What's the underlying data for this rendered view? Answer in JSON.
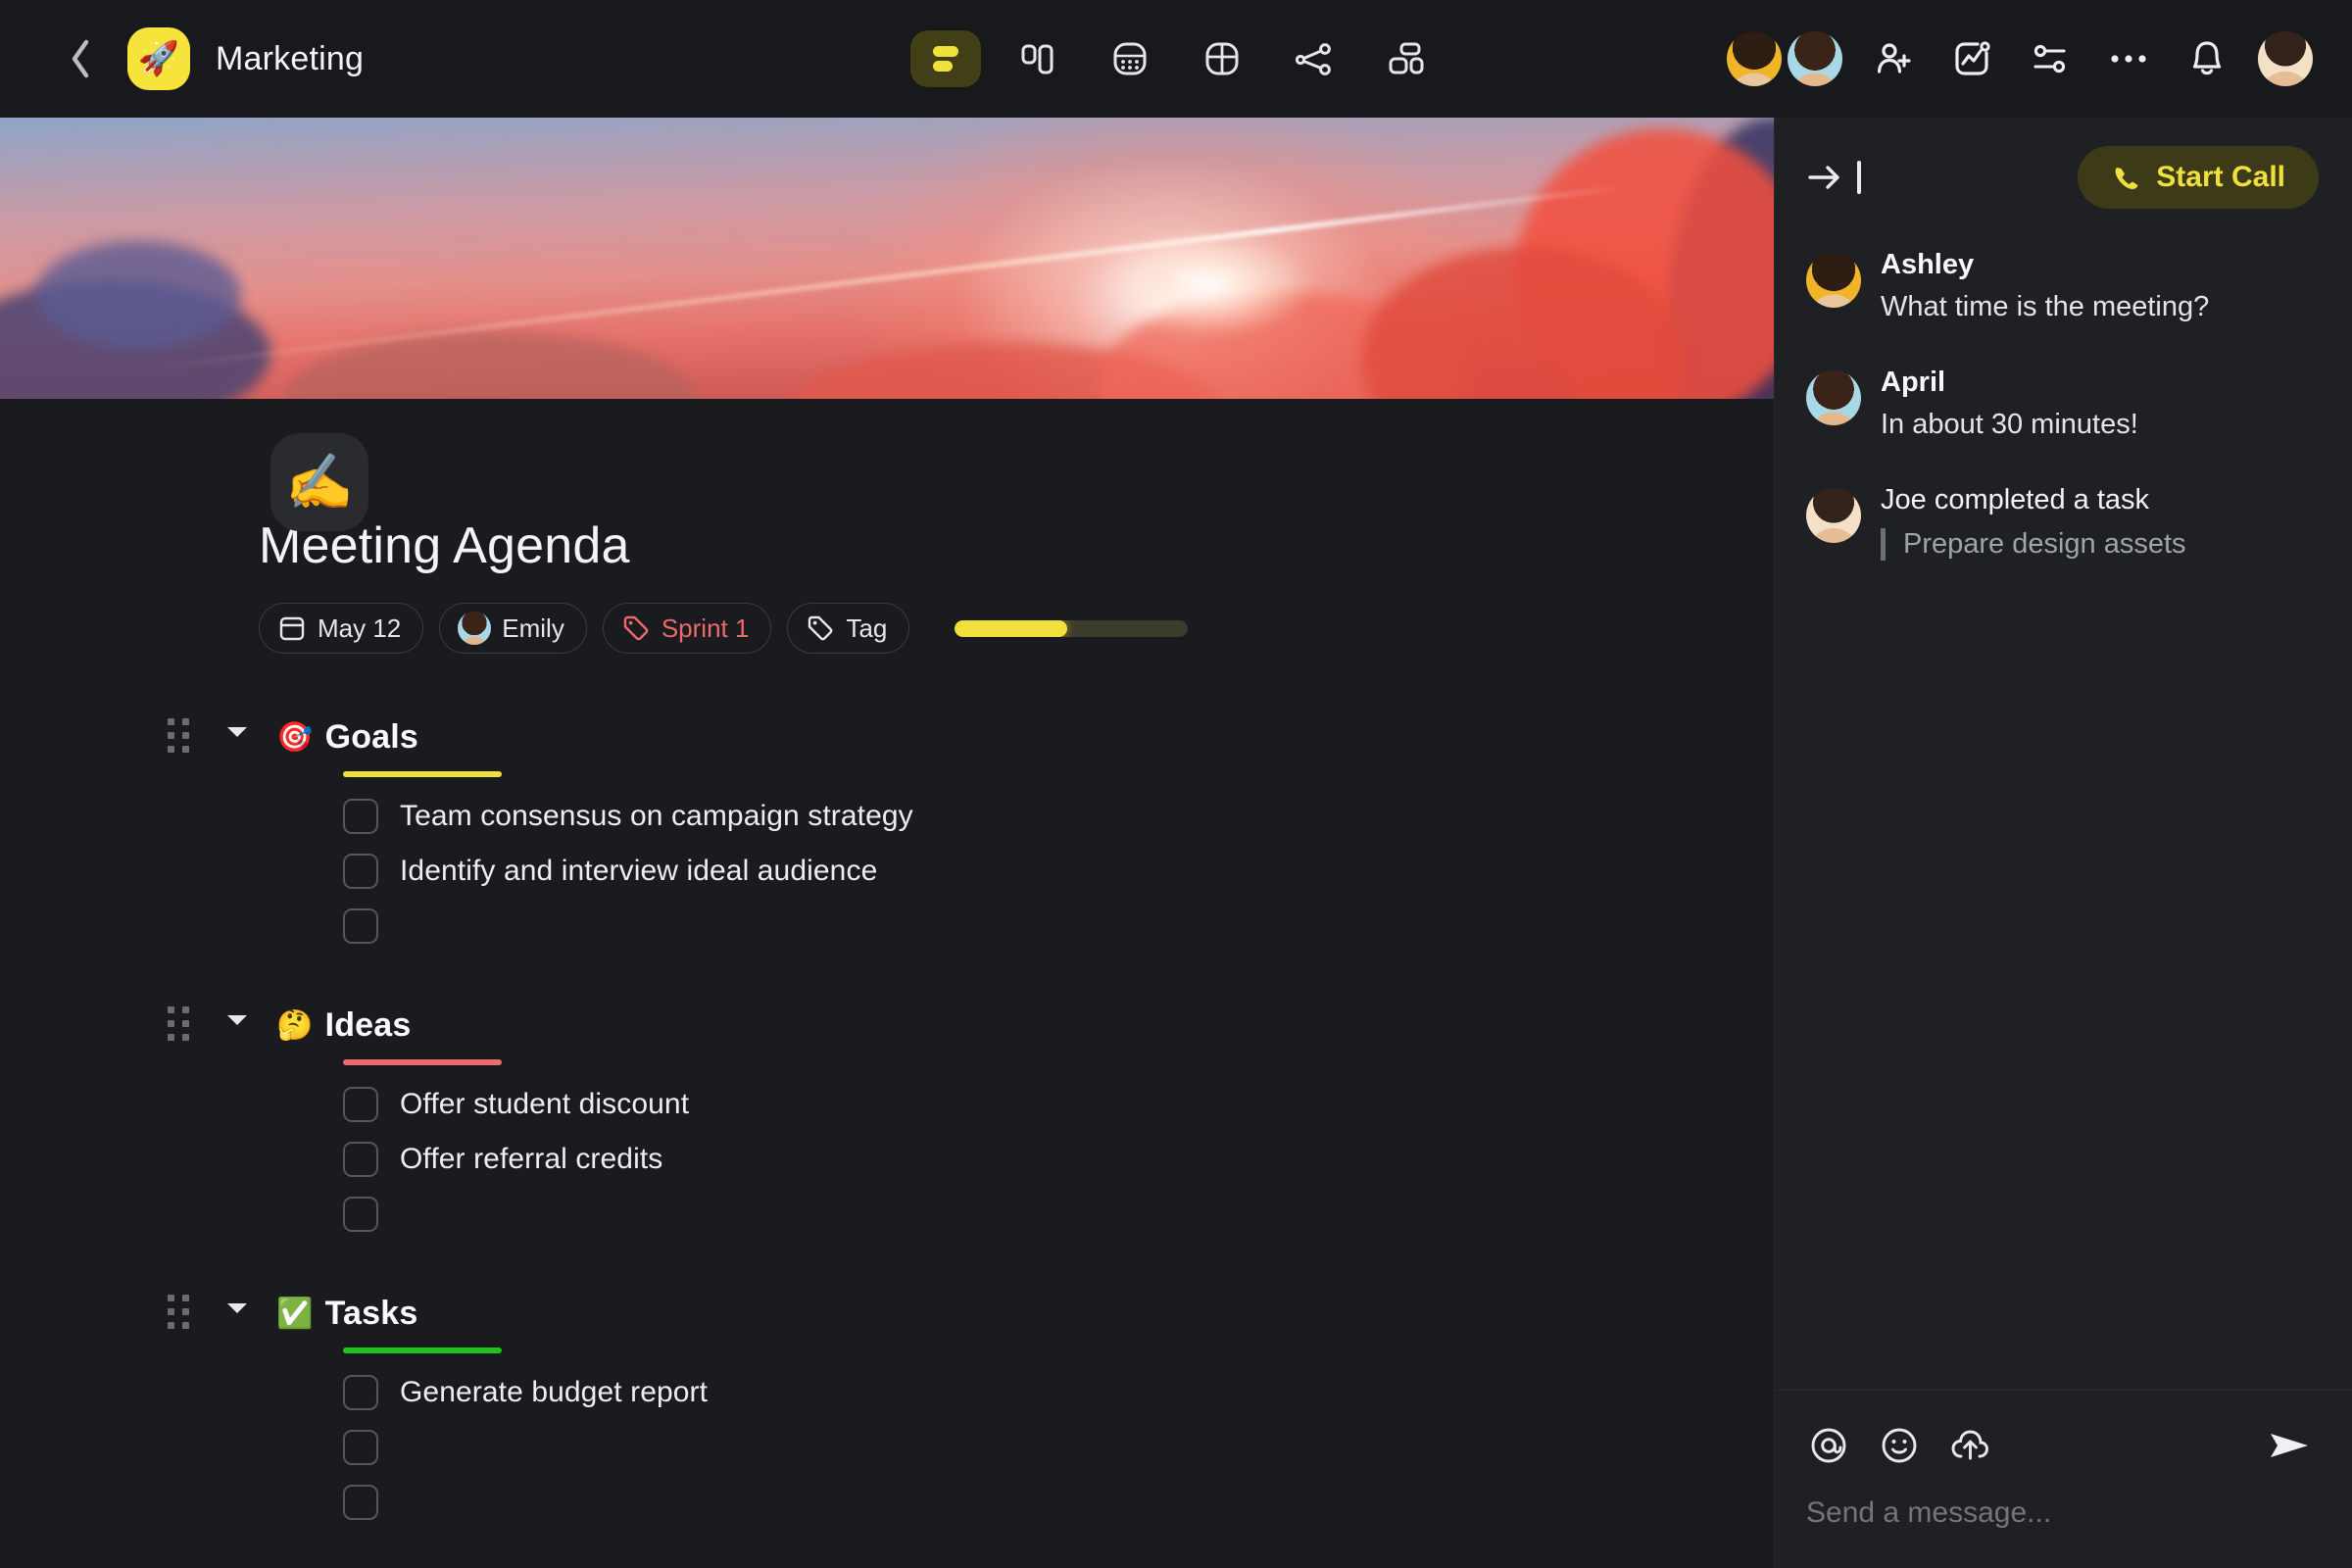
{
  "topbar": {
    "back_icon": "chevron-left-icon",
    "space_emoji": "🚀",
    "space_title": "Marketing",
    "views": [
      {
        "name": "list-view",
        "icon": "list-rows-icon",
        "active": true
      },
      {
        "name": "board-view",
        "icon": "columns-icon",
        "active": false
      },
      {
        "name": "calendar-view",
        "icon": "calendar-dots-icon",
        "active": false
      },
      {
        "name": "table-view",
        "icon": "table-grid-icon",
        "active": false
      },
      {
        "name": "graph-view",
        "icon": "share-nodes-icon",
        "active": false
      },
      {
        "name": "dashboard-view",
        "icon": "blocks-icon",
        "active": false
      }
    ],
    "members": [
      "Ashley",
      "April"
    ],
    "actions": [
      {
        "name": "invite-member",
        "icon": "user-plus-icon"
      },
      {
        "name": "activity",
        "icon": "activity-chart-icon"
      },
      {
        "name": "filters",
        "icon": "sliders-icon"
      },
      {
        "name": "more-options",
        "icon": "ellipsis-icon"
      },
      {
        "name": "notifications",
        "icon": "bell-icon"
      }
    ],
    "account": "Joe"
  },
  "document": {
    "cover_alt": "sunset-clouds-cover",
    "emoji": "✍️",
    "title": "Meeting Agenda",
    "pills": [
      {
        "name": "date-pill",
        "icon": "calendar-icon",
        "label": "May 12"
      },
      {
        "name": "assignee-pill",
        "icon": "avatar",
        "label": "Emily"
      },
      {
        "name": "sprint-tag-pill",
        "icon": "tag-icon",
        "label": "Sprint 1",
        "color": "#ed6a6a"
      },
      {
        "name": "add-tag-pill",
        "icon": "tag-icon",
        "label": "Tag"
      }
    ],
    "progress": {
      "percent": 48,
      "fill_color": "#f1e03c",
      "track_color": "#3c3c2c"
    }
  },
  "sections": [
    {
      "emoji": "🎯",
      "label": "Goals",
      "underline_color": "#f1e03c",
      "collapsed": false,
      "items": [
        {
          "text": "Team consensus on campaign strategy",
          "checked": false
        },
        {
          "text": "Identify and interview ideal audience",
          "checked": false
        },
        {
          "text": "",
          "checked": false
        }
      ]
    },
    {
      "emoji": "🤔",
      "label": "Ideas",
      "underline_color": "#ef6a6a",
      "collapsed": false,
      "items": [
        {
          "text": "Offer student discount",
          "checked": false
        },
        {
          "text": "Offer referral credits",
          "checked": false
        },
        {
          "text": "",
          "checked": false
        }
      ]
    },
    {
      "emoji": "✅",
      "label": "Tasks",
      "underline_color": "#1fc41f",
      "collapsed": false,
      "items": [
        {
          "text": "Generate budget report",
          "checked": false
        },
        {
          "text": "",
          "checked": false
        },
        {
          "text": "",
          "checked": false
        }
      ]
    }
  ],
  "panel": {
    "collapse_icon": "arrow-right-to-line-icon",
    "start_call": {
      "label": "Start Call",
      "icon": "phone-icon",
      "color": "#f0e03e"
    },
    "messages": [
      {
        "type": "message",
        "author": "Ashley",
        "text": "What time is the meeting?",
        "avatar": "av-ashley"
      },
      {
        "type": "message",
        "author": "April",
        "text": "In about 30 minutes!",
        "avatar": "av-april"
      },
      {
        "type": "event",
        "title": "Joe completed a task",
        "quote": "Prepare design assets",
        "avatar": "av-joe"
      }
    ],
    "composer": {
      "placeholder": "Send a message...",
      "tools": [
        {
          "name": "mention-icon",
          "glyph": "@"
        },
        {
          "name": "emoji-icon",
          "glyph": "smiley"
        },
        {
          "name": "upload-icon",
          "glyph": "cloud-upload"
        }
      ],
      "send_icon": "send-paper-plane-icon"
    }
  }
}
